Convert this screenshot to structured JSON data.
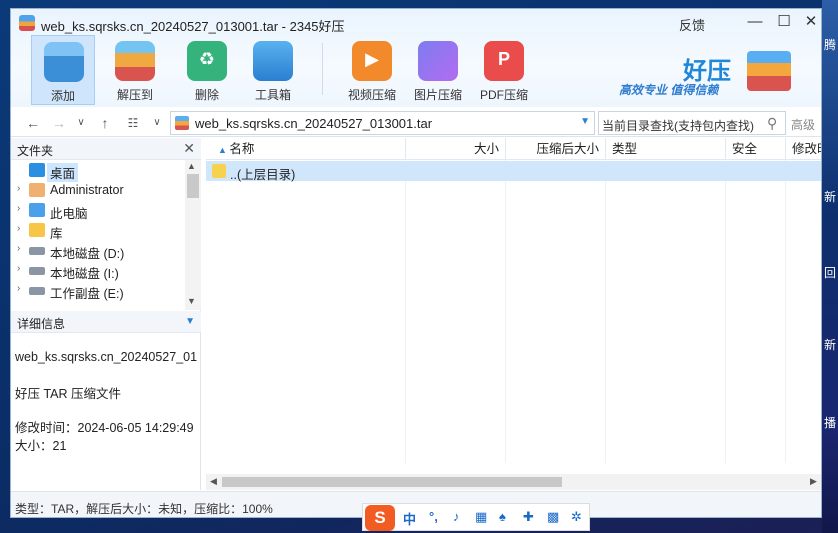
{
  "window": {
    "title": "web_ks.sqrsks.cn_20240527_013001.tar - 2345好压",
    "feedback": "反馈",
    "controls": {
      "minimize": "—",
      "maximize": "☐",
      "close": "✕"
    }
  },
  "toolbar": {
    "items": [
      {
        "label": "添加",
        "icon": "add-icon"
      },
      {
        "label": "解压到",
        "icon": "extract-icon"
      },
      {
        "label": "删除",
        "icon": "delete-icon"
      },
      {
        "label": "工具箱",
        "icon": "toolbox-icon"
      },
      {
        "label": "视频压缩",
        "icon": "video-compress-icon"
      },
      {
        "label": "图片压缩",
        "icon": "image-compress-icon"
      },
      {
        "label": "PDF压缩",
        "icon": "pdf-compress-icon"
      }
    ]
  },
  "brand": {
    "name": "好压",
    "slogan": "高效专业 值得信赖"
  },
  "address": {
    "path": "web_ks.sqrsks.cn_20240527_013001.tar",
    "search_placeholder": "当前目录查找(支持包内查找)",
    "advanced": "高级"
  },
  "folders_panel": {
    "title": "文件夹",
    "items": [
      {
        "label": "桌面",
        "icon": "desktop-icon",
        "selected": true
      },
      {
        "label": "Administrator",
        "icon": "user-icon"
      },
      {
        "label": "此电脑",
        "icon": "computer-icon"
      },
      {
        "label": "库",
        "icon": "library-icon"
      },
      {
        "label": "本地磁盘 (D:)",
        "icon": "disk-icon"
      },
      {
        "label": "本地磁盘 (I:)",
        "icon": "disk-icon"
      },
      {
        "label": "工作副盘 (E:)",
        "icon": "disk-icon"
      }
    ]
  },
  "details_panel": {
    "title": "详细信息",
    "filename": "web_ks.sqrsks.cn_20240527_01",
    "filetype": "好压 TAR 压缩文件",
    "modified": "修改时间：2024-06-05 14:29:49",
    "size": "大小：21"
  },
  "file_list": {
    "columns": [
      "名称",
      "大小",
      "压缩后大小",
      "类型",
      "安全",
      "修改时"
    ],
    "rows": [
      {
        "name": "..(上层目录)"
      }
    ]
  },
  "status_bar": "类型：TAR，解压后大小：未知，压缩比：100%",
  "ime": {
    "mode": "中"
  },
  "desktop": {
    "right_labels": [
      "腾",
      "新",
      "回",
      "新",
      "播"
    ]
  }
}
